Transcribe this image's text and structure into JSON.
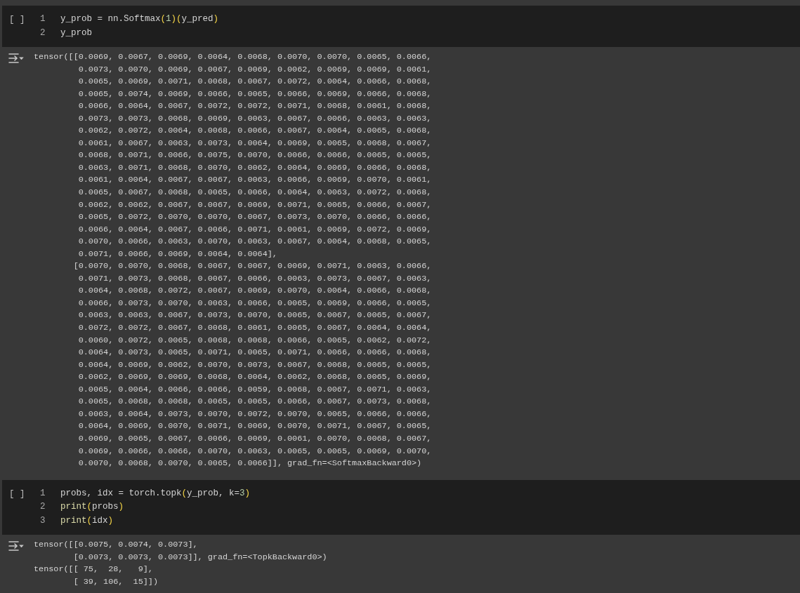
{
  "cells": [
    {
      "run_button": "[ ]",
      "lines": [
        {
          "number": "1",
          "tokens": [
            {
              "kind": "plain",
              "text": "y_prob = nn.Softmax"
            },
            {
              "kind": "paren",
              "text": "("
            },
            {
              "kind": "number",
              "text": "1"
            },
            {
              "kind": "paren",
              "text": ")("
            },
            {
              "kind": "plain",
              "text": "y_pred"
            },
            {
              "kind": "paren",
              "text": ")"
            }
          ]
        },
        {
          "number": "2",
          "tokens": [
            {
              "kind": "plain",
              "text": "y_prob"
            }
          ]
        }
      ],
      "output": [
        "tensor([[0.0069, 0.0067, 0.0069, 0.0064, 0.0068, 0.0070, 0.0070, 0.0065, 0.0066,",
        "         0.0073, 0.0070, 0.0069, 0.0067, 0.0069, 0.0062, 0.0069, 0.0069, 0.0061,",
        "         0.0065, 0.0069, 0.0071, 0.0068, 0.0067, 0.0072, 0.0064, 0.0066, 0.0068,",
        "         0.0065, 0.0074, 0.0069, 0.0066, 0.0065, 0.0066, 0.0069, 0.0066, 0.0068,",
        "         0.0066, 0.0064, 0.0067, 0.0072, 0.0072, 0.0071, 0.0068, 0.0061, 0.0068,",
        "         0.0073, 0.0073, 0.0068, 0.0069, 0.0063, 0.0067, 0.0066, 0.0063, 0.0063,",
        "         0.0062, 0.0072, 0.0064, 0.0068, 0.0066, 0.0067, 0.0064, 0.0065, 0.0068,",
        "         0.0061, 0.0067, 0.0063, 0.0073, 0.0064, 0.0069, 0.0065, 0.0068, 0.0067,",
        "         0.0068, 0.0071, 0.0066, 0.0075, 0.0070, 0.0066, 0.0066, 0.0065, 0.0065,",
        "         0.0063, 0.0071, 0.0068, 0.0070, 0.0062, 0.0064, 0.0069, 0.0066, 0.0068,",
        "         0.0061, 0.0064, 0.0067, 0.0067, 0.0063, 0.0066, 0.0069, 0.0070, 0.0061,",
        "         0.0065, 0.0067, 0.0068, 0.0065, 0.0066, 0.0064, 0.0063, 0.0072, 0.0068,",
        "         0.0062, 0.0062, 0.0067, 0.0067, 0.0069, 0.0071, 0.0065, 0.0066, 0.0067,",
        "         0.0065, 0.0072, 0.0070, 0.0070, 0.0067, 0.0073, 0.0070, 0.0066, 0.0066,",
        "         0.0066, 0.0064, 0.0067, 0.0066, 0.0071, 0.0061, 0.0069, 0.0072, 0.0069,",
        "         0.0070, 0.0066, 0.0063, 0.0070, 0.0063, 0.0067, 0.0064, 0.0068, 0.0065,",
        "         0.0071, 0.0066, 0.0069, 0.0064, 0.0064],",
        "        [0.0070, 0.0070, 0.0068, 0.0067, 0.0067, 0.0069, 0.0071, 0.0063, 0.0066,",
        "         0.0071, 0.0073, 0.0068, 0.0067, 0.0066, 0.0063, 0.0073, 0.0067, 0.0063,",
        "         0.0064, 0.0068, 0.0072, 0.0067, 0.0069, 0.0070, 0.0064, 0.0066, 0.0068,",
        "         0.0066, 0.0073, 0.0070, 0.0063, 0.0066, 0.0065, 0.0069, 0.0066, 0.0065,",
        "         0.0063, 0.0063, 0.0067, 0.0073, 0.0070, 0.0065, 0.0067, 0.0065, 0.0067,",
        "         0.0072, 0.0072, 0.0067, 0.0068, 0.0061, 0.0065, 0.0067, 0.0064, 0.0064,",
        "         0.0060, 0.0072, 0.0065, 0.0068, 0.0068, 0.0066, 0.0065, 0.0062, 0.0072,",
        "         0.0064, 0.0073, 0.0065, 0.0071, 0.0065, 0.0071, 0.0066, 0.0066, 0.0068,",
        "         0.0064, 0.0069, 0.0062, 0.0070, 0.0073, 0.0067, 0.0068, 0.0065, 0.0065,",
        "         0.0062, 0.0069, 0.0069, 0.0068, 0.0064, 0.0062, 0.0068, 0.0065, 0.0069,",
        "         0.0065, 0.0064, 0.0066, 0.0066, 0.0059, 0.0068, 0.0067, 0.0071, 0.0063,",
        "         0.0065, 0.0068, 0.0068, 0.0065, 0.0065, 0.0066, 0.0067, 0.0073, 0.0068,",
        "         0.0063, 0.0064, 0.0073, 0.0070, 0.0072, 0.0070, 0.0065, 0.0066, 0.0066,",
        "         0.0064, 0.0069, 0.0070, 0.0071, 0.0069, 0.0070, 0.0071, 0.0067, 0.0065,",
        "         0.0069, 0.0065, 0.0067, 0.0066, 0.0069, 0.0061, 0.0070, 0.0068, 0.0067,",
        "         0.0069, 0.0066, 0.0066, 0.0070, 0.0063, 0.0065, 0.0065, 0.0069, 0.0070,",
        "         0.0070, 0.0068, 0.0070, 0.0065, 0.0066]], grad_fn=<SoftmaxBackward0>)"
      ]
    },
    {
      "run_button": "[ ]",
      "lines": [
        {
          "number": "1",
          "tokens": [
            {
              "kind": "plain",
              "text": "probs, idx = torch.topk"
            },
            {
              "kind": "paren",
              "text": "("
            },
            {
              "kind": "plain",
              "text": "y_prob, k="
            },
            {
              "kind": "number",
              "text": "3"
            },
            {
              "kind": "paren",
              "text": ")"
            }
          ]
        },
        {
          "number": "2",
          "tokens": [
            {
              "kind": "func",
              "text": "print"
            },
            {
              "kind": "paren",
              "text": "("
            },
            {
              "kind": "plain",
              "text": "probs"
            },
            {
              "kind": "paren",
              "text": ")"
            }
          ]
        },
        {
          "number": "3",
          "tokens": [
            {
              "kind": "func",
              "text": "print"
            },
            {
              "kind": "paren",
              "text": "("
            },
            {
              "kind": "plain",
              "text": "idx"
            },
            {
              "kind": "paren",
              "text": ")"
            }
          ]
        }
      ],
      "output": [
        "tensor([[0.0075, 0.0074, 0.0073],",
        "        [0.0073, 0.0073, 0.0073]], grad_fn=<TopkBackward0>)",
        "tensor([[ 75,  28,   9],",
        "        [ 39, 106,  15]])"
      ]
    }
  ]
}
